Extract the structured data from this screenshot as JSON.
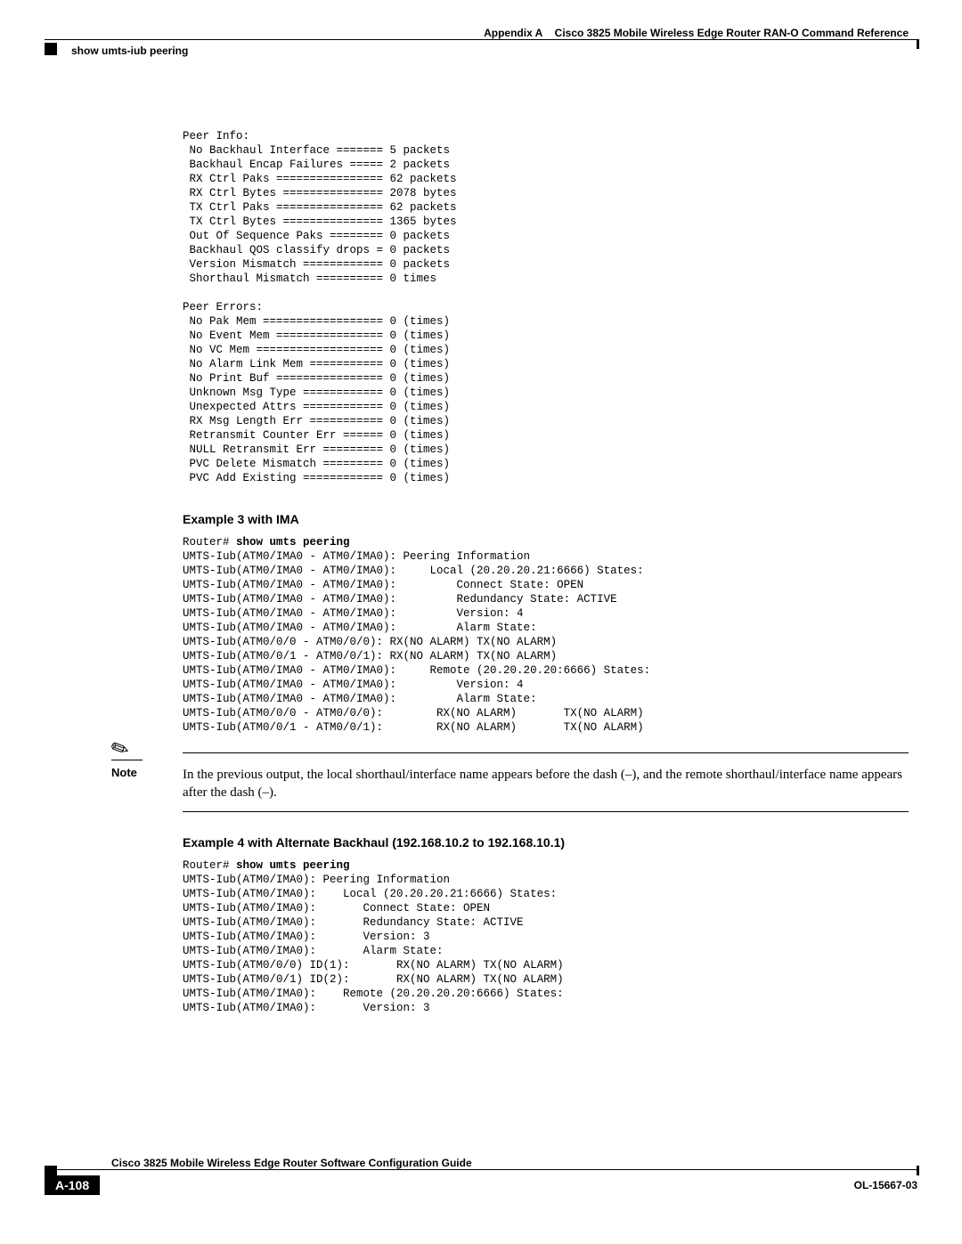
{
  "header": {
    "appendix": "Appendix A",
    "title": "Cisco 3825 Mobile Wireless Edge Router RAN-O Command Reference",
    "section": "show umts-iub peering"
  },
  "peerInfo": "Peer Info:\n No Backhaul Interface ======= 5 packets\n Backhaul Encap Failures ===== 2 packets\n RX Ctrl Paks ================ 62 packets\n RX Ctrl Bytes =============== 2078 bytes\n TX Ctrl Paks ================ 62 packets\n TX Ctrl Bytes =============== 1365 bytes\n Out Of Sequence Paks ======== 0 packets\n Backhaul QOS classify drops = 0 packets\n Version Mismatch ============ 0 packets\n Shorthaul Mismatch ========== 0 times\n\nPeer Errors:\n No Pak Mem ================== 0 (times)\n No Event Mem ================ 0 (times)\n No VC Mem =================== 0 (times)\n No Alarm Link Mem =========== 0 (times)\n No Print Buf ================ 0 (times)\n Unknown Msg Type ============ 0 (times)\n Unexpected Attrs ============ 0 (times)\n RX Msg Length Err =========== 0 (times)\n Retransmit Counter Err ====== 0 (times)\n NULL Retransmit Err ========= 0 (times)\n PVC Delete Mismatch ========= 0 (times)\n PVC Add Existing ============ 0 (times)",
  "example3": {
    "heading": "Example 3 with IMA",
    "prompt": "Router# ",
    "command": "show umts peering",
    "output": "UMTS-Iub(ATM0/IMA0 - ATM0/IMA0): Peering Information\nUMTS-Iub(ATM0/IMA0 - ATM0/IMA0):     Local (20.20.20.21:6666) States:\nUMTS-Iub(ATM0/IMA0 - ATM0/IMA0):         Connect State: OPEN\nUMTS-Iub(ATM0/IMA0 - ATM0/IMA0):         Redundancy State: ACTIVE\nUMTS-Iub(ATM0/IMA0 - ATM0/IMA0):         Version: 4\nUMTS-Iub(ATM0/IMA0 - ATM0/IMA0):         Alarm State:\nUMTS-Iub(ATM0/0/0 - ATM0/0/0): RX(NO ALARM) TX(NO ALARM)\nUMTS-Iub(ATM0/0/1 - ATM0/0/1): RX(NO ALARM) TX(NO ALARM)\nUMTS-Iub(ATM0/IMA0 - ATM0/IMA0):     Remote (20.20.20.20:6666) States:\nUMTS-Iub(ATM0/IMA0 - ATM0/IMA0):         Version: 4\nUMTS-Iub(ATM0/IMA0 - ATM0/IMA0):         Alarm State:\nUMTS-Iub(ATM0/0/0 - ATM0/0/0):        RX(NO ALARM)       TX(NO ALARM)\nUMTS-Iub(ATM0/0/1 - ATM0/0/1):        RX(NO ALARM)       TX(NO ALARM)"
  },
  "note": {
    "label": "Note",
    "text": "In the previous output, the local shorthaul/interface name appears before the dash (–), and the remote shorthaul/interface name appears after the dash (–)."
  },
  "example4": {
    "heading": "Example 4 with Alternate Backhaul (192.168.10.2 to 192.168.10.1)",
    "prompt": "Router# ",
    "command": "show umts peering",
    "output": "UMTS-Iub(ATM0/IMA0): Peering Information\nUMTS-Iub(ATM0/IMA0):    Local (20.20.20.21:6666) States:\nUMTS-Iub(ATM0/IMA0):       Connect State: OPEN\nUMTS-Iub(ATM0/IMA0):       Redundancy State: ACTIVE\nUMTS-Iub(ATM0/IMA0):       Version: 3\nUMTS-Iub(ATM0/IMA0):       Alarm State:\nUMTS-Iub(ATM0/0/0) ID(1):       RX(NO ALARM) TX(NO ALARM)\nUMTS-Iub(ATM0/0/1) ID(2):       RX(NO ALARM) TX(NO ALARM)\nUMTS-Iub(ATM0/IMA0):    Remote (20.20.20.20:6666) States:\nUMTS-Iub(ATM0/IMA0):       Version: 3"
  },
  "footer": {
    "title": "Cisco 3825 Mobile Wireless Edge Router Software Configuration Guide",
    "page": "A-108",
    "docId": "OL-15667-03"
  }
}
